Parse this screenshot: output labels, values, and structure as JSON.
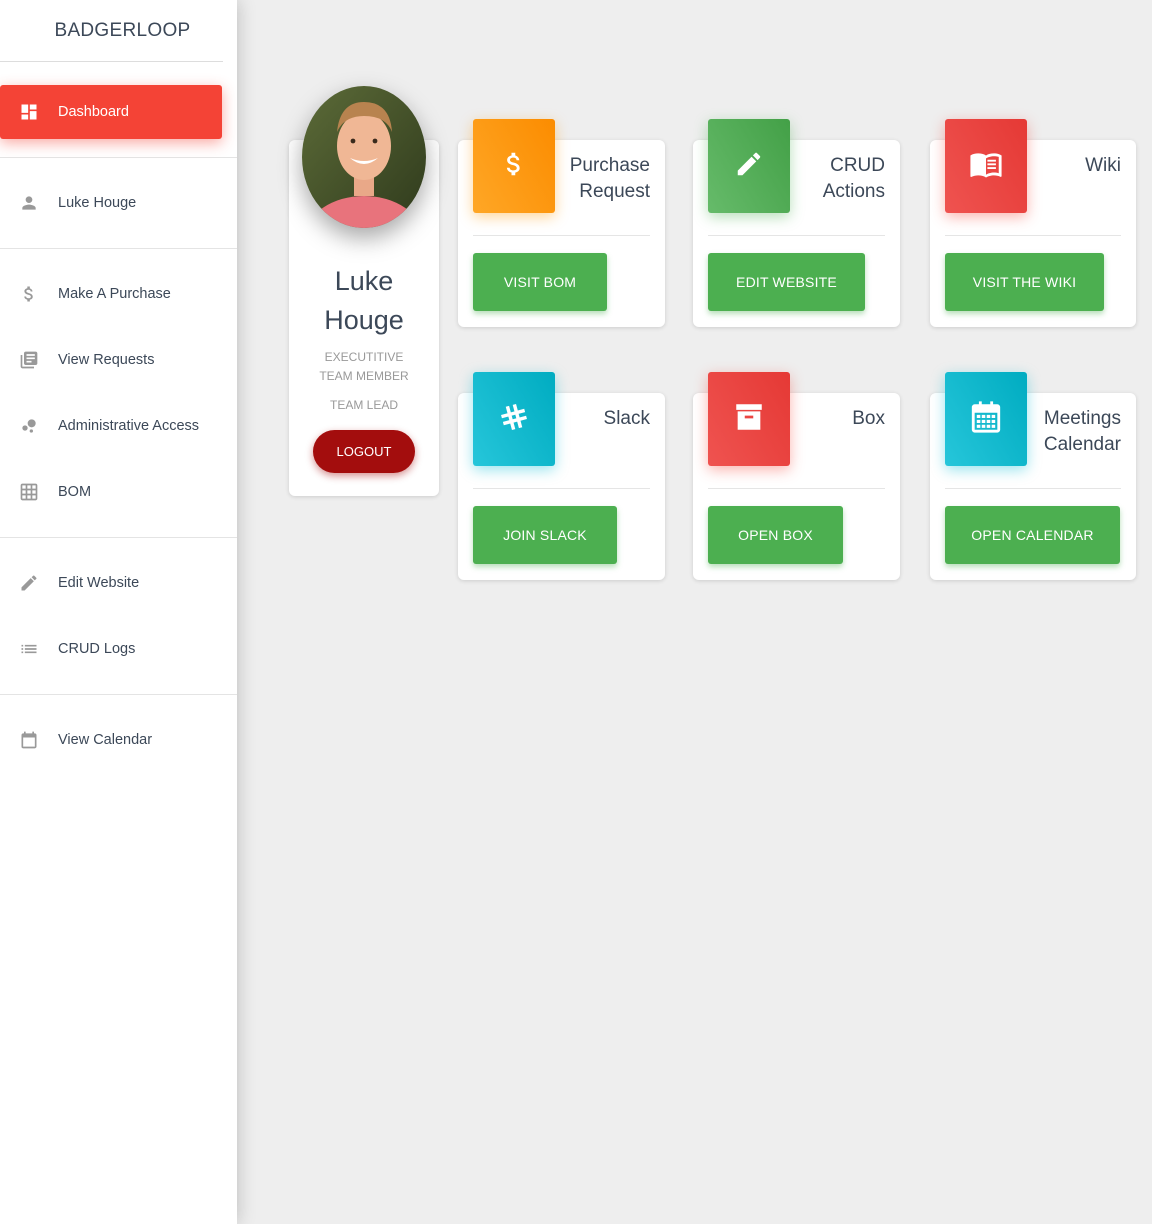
{
  "brand": "BADGERLOOP",
  "sidebar": {
    "active": {
      "label": "Dashboard",
      "icon": "dashboard-icon"
    },
    "user": {
      "label": "Luke Houge",
      "icon": "person-icon"
    },
    "group1": [
      {
        "label": "Make A Purchase",
        "icon": "dollar-icon"
      },
      {
        "label": "View Requests",
        "icon": "library-books-icon"
      },
      {
        "label": "Administrative Access",
        "icon": "bubble-chart-icon"
      },
      {
        "label": "BOM",
        "icon": "grid-icon"
      }
    ],
    "group2": [
      {
        "label": "Edit Website",
        "icon": "pencil-icon"
      },
      {
        "label": "CRUD Logs",
        "icon": "list-icon"
      }
    ],
    "group3": [
      {
        "label": "View Calendar",
        "icon": "calendar-icon"
      }
    ]
  },
  "profile": {
    "first_name": "Luke",
    "last_name": "Houge",
    "role": "EXECUTITIVE TEAM MEMBER",
    "position": "TEAM LEAD",
    "logout_label": "LOGOUT"
  },
  "tiles": [
    {
      "title_line1": "Purchase",
      "title_line2": "Request",
      "button": "VISIT BOM",
      "icon": "dollar-icon",
      "color": "#fb8c00"
    },
    {
      "title_line1": "CRUD",
      "title_line2": "Actions",
      "button": "EDIT WEBSITE",
      "icon": "pencil-icon",
      "color": "#43a047"
    },
    {
      "title_line1": "Wiki",
      "title_line2": "",
      "button": "VISIT THE WIKI",
      "icon": "book-icon",
      "color": "#e53935"
    },
    {
      "title_line1": "Slack",
      "title_line2": "",
      "button": "JOIN SLACK",
      "icon": "slack-icon",
      "color": "#00acc1"
    },
    {
      "title_line1": "Box",
      "title_line2": "",
      "button": "OPEN BOX",
      "icon": "archive-icon",
      "color": "#e53935"
    },
    {
      "title_line1": "Meetings",
      "title_line2": "Calendar",
      "button": "OPEN CALENDAR",
      "icon": "calendar-icon",
      "color": "#00acc1"
    }
  ],
  "colors": {
    "active_nav": "#f44336",
    "button_green": "#4caf50",
    "logout": "#a30d0d"
  }
}
